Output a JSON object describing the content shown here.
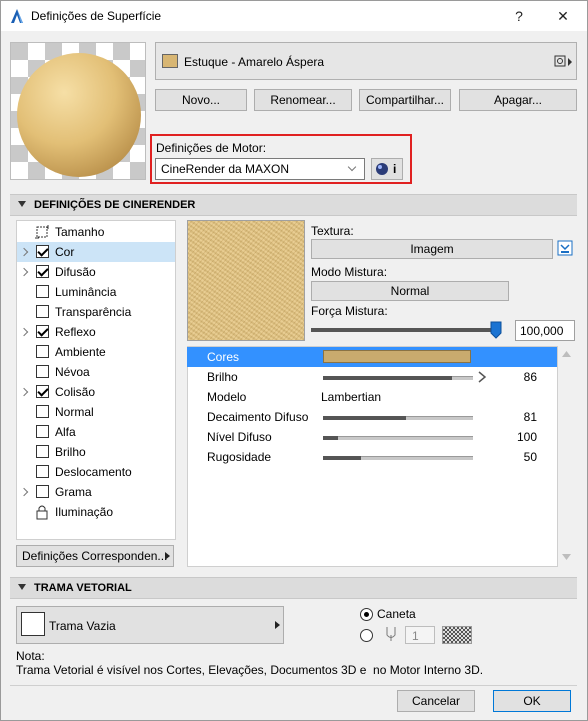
{
  "window": {
    "title": "Definições de Superfície",
    "help_label": "?",
    "close_label": "✕"
  },
  "surface": {
    "name": "Estuque - Amarelo Áspera",
    "swatch_color": "#d8b673"
  },
  "top_buttons": {
    "new": "Novo...",
    "rename": "Renomear...",
    "share": "Compartilhar...",
    "delete": "Apagar..."
  },
  "engine": {
    "label": "Definições de Motor:",
    "selected": "CineRender da MAXON",
    "info_label": "i"
  },
  "cinerender": {
    "section_title": "DEFINIÇÕES DE CINERENDER",
    "channels": [
      {
        "label": "Tamanho",
        "kind": "icon",
        "expand": false
      },
      {
        "label": "Cor",
        "kind": "checkbox",
        "checked": true,
        "expand": true,
        "selected": true
      },
      {
        "label": "Difusão",
        "kind": "checkbox",
        "checked": true,
        "expand": true
      },
      {
        "label": "Luminância",
        "kind": "checkbox",
        "checked": false,
        "expand": false
      },
      {
        "label": "Transparência",
        "kind": "checkbox",
        "checked": false,
        "expand": false
      },
      {
        "label": "Reflexo",
        "kind": "checkbox",
        "checked": true,
        "expand": true
      },
      {
        "label": "Ambiente",
        "kind": "checkbox",
        "checked": false,
        "expand": false
      },
      {
        "label": "Névoa",
        "kind": "checkbox",
        "checked": false,
        "expand": false
      },
      {
        "label": "Colisão",
        "kind": "checkbox",
        "checked": true,
        "expand": true
      },
      {
        "label": "Normal",
        "kind": "checkbox",
        "checked": false,
        "expand": false
      },
      {
        "label": "Alfa",
        "kind": "checkbox",
        "checked": false,
        "expand": false
      },
      {
        "label": "Brilho",
        "kind": "checkbox",
        "checked": false,
        "expand": false
      },
      {
        "label": "Deslocamento",
        "kind": "checkbox",
        "checked": false,
        "expand": false
      },
      {
        "label": "Grama",
        "kind": "checkbox",
        "checked": false,
        "expand": true
      },
      {
        "label": "Iluminação",
        "kind": "icon",
        "expand": false
      }
    ],
    "matching_button": "Definições Corresponden...",
    "texture_label": "Textura:",
    "image_button": "Imagem",
    "blend_mode_label": "Modo Mistura:",
    "blend_mode_value": "Normal",
    "blend_strength_label": "Força Mistura:",
    "blend_strength_value": "100,000",
    "blend_strength_fraction": 1.0,
    "properties": [
      {
        "name": "Cores",
        "kind": "color",
        "color": "#c9ab6e",
        "selected": true
      },
      {
        "name": "Brilho",
        "kind": "slider",
        "value": "86",
        "fraction": 0.86,
        "arrow": true
      },
      {
        "name": "Modelo",
        "kind": "text",
        "value": "Lambertian"
      },
      {
        "name": "Decaimento Difuso",
        "kind": "slider",
        "value": "81",
        "fraction": 0.55
      },
      {
        "name": "Nível Difuso",
        "kind": "slider",
        "value": "100",
        "fraction": 0.1
      },
      {
        "name": "Rugosidade",
        "kind": "slider",
        "value": "50",
        "fraction": 0.25
      }
    ]
  },
  "vector_hatch": {
    "section_title": "TRAMA VETORIAL",
    "pattern": "Trama Vazia",
    "pen_label": "Caneta",
    "pen_number": "1"
  },
  "note": {
    "title": "Nota:",
    "text": "Trama Vetorial é visível nos Cortes, Elevações, Documentos 3D e  no Motor Interno 3D."
  },
  "footer": {
    "cancel": "Cancelar",
    "ok": "OK"
  }
}
